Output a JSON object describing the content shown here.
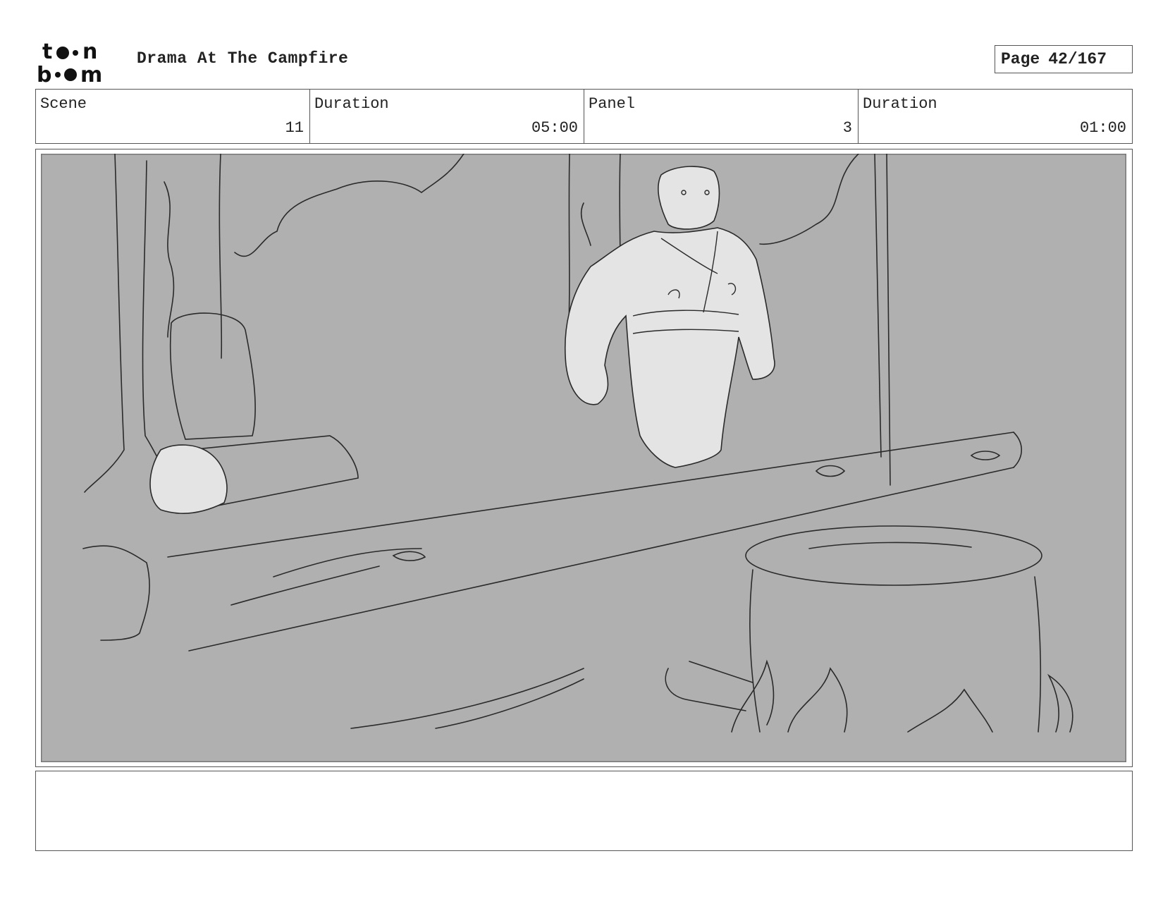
{
  "header": {
    "logo_alt": "toon boom",
    "title": "Drama At The Campfire",
    "page_label": "Page",
    "page_value": "42/167"
  },
  "info": {
    "scene_label": "Scene",
    "scene_value": "11",
    "duration_label": "Duration",
    "duration_value": "05:00",
    "panel_label": "Panel",
    "panel_value": "3",
    "panel_duration_label": "Duration",
    "panel_duration_value": "01:00"
  },
  "panel": {
    "background_color": "#b0b0b0",
    "figure_fill": "#e4e4e4",
    "line_color": "#2a2a2a"
  },
  "notes": {
    "text": ""
  }
}
